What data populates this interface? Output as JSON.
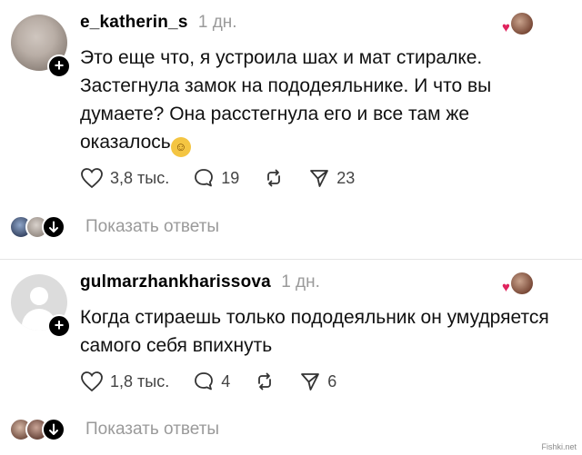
{
  "comments": [
    {
      "username": "e_katherin_s",
      "time": "1 дн.",
      "avatar_icon": "user-photo",
      "text": "Это еще что, я устроила шах и мат стиралке. Застегнула замок на пододеяльнике. И что вы думаете? Она расстегнула его и все там же оказалось",
      "emoji": "rofl-emoji",
      "likes": "3,8 тыс.",
      "replies_count": "19",
      "reposts_icon": "repost-icon",
      "shares": "23",
      "show_replies": "Показать ответы"
    },
    {
      "username": "gulmarzhankharissova",
      "time": "1 дн.",
      "avatar_icon": "default-user-avatar",
      "text": "Когда стираешь только пододеяльник он умудряется самого себя впихнуть",
      "likes": "1,8 тыс.",
      "replies_count": "4",
      "reposts_icon": "repost-icon",
      "shares": "6",
      "show_replies": "Показать ответы"
    }
  ],
  "colors": {
    "author_heart": "#e0245e",
    "muted_text": "#9a9a9a"
  },
  "watermark": "Fishki.net"
}
